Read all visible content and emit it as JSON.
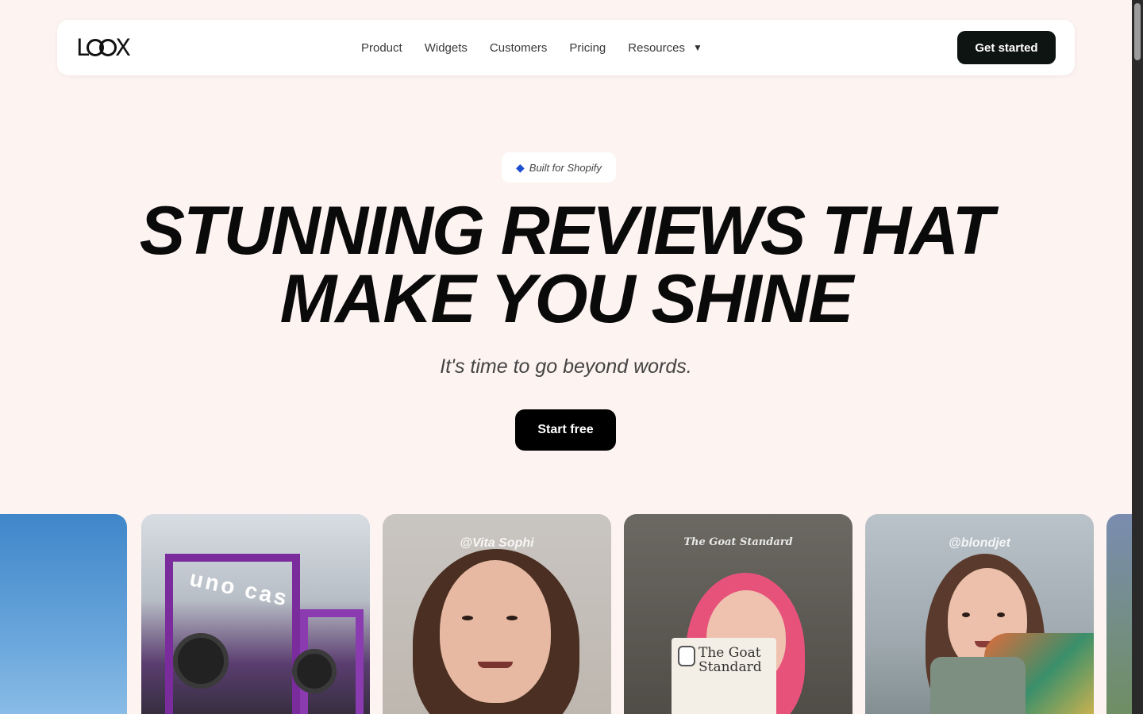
{
  "nav": {
    "logo": "LOOX",
    "links": [
      "Product",
      "Widgets",
      "Customers",
      "Pricing",
      "Resources"
    ],
    "cta": "Get started"
  },
  "hero": {
    "badge": "Built for Shopify",
    "headline_line1": "STUNNING REVIEWS THAT",
    "headline_line2": "MAKE YOU SHINE",
    "subtitle": "It's time to go beyond words.",
    "cta": "Start free"
  },
  "cards": {
    "handles": [
      "",
      "",
      "@Vita Sophi",
      "The Goat Standard",
      "@blondjet",
      ""
    ],
    "product_box_line1": "The Goat",
    "product_box_line2": "Standard",
    "gym_sign": "uno cas"
  }
}
